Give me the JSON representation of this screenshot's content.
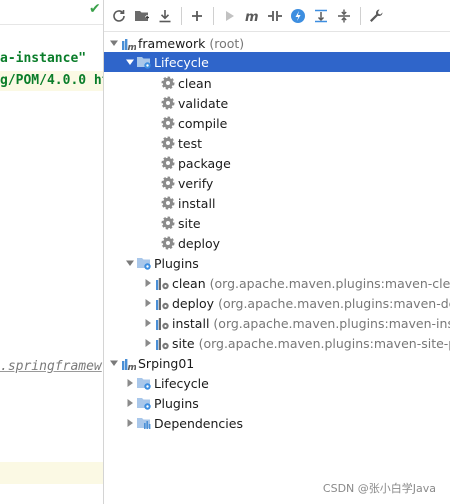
{
  "editor": {
    "code_lines": [
      "a-instance\"",
      "g/POM/4.0.0 ht"
    ],
    "link_line": ".springframew"
  },
  "toolbar": {
    "buttons": [
      {
        "name": "reload-icon"
      },
      {
        "name": "add-project-folder-icon"
      },
      {
        "name": "download-icon"
      },
      {
        "name": "plus-icon"
      },
      {
        "name": "run-icon"
      },
      {
        "name": "execute-goal-icon"
      },
      {
        "name": "toggle-offline-icon"
      },
      {
        "name": "skip-tests-icon"
      },
      {
        "name": "show-dependencies-icon"
      },
      {
        "name": "collapse-all-icon"
      },
      {
        "name": "settings-wrench-icon"
      }
    ]
  },
  "tree": {
    "framework": {
      "label": "framework",
      "suffix": "(root)"
    },
    "lifecycle": {
      "label": "Lifecycle"
    },
    "phases": [
      "clean",
      "validate",
      "compile",
      "test",
      "package",
      "verify",
      "install",
      "site",
      "deploy"
    ],
    "plugins": {
      "label": "Plugins"
    },
    "plugin_items": [
      {
        "label": "clean",
        "detail": "(org.apache.maven.plugins:maven-clean-"
      },
      {
        "label": "deploy",
        "detail": "(org.apache.maven.plugins:maven-depl"
      },
      {
        "label": "install",
        "detail": "(org.apache.maven.plugins:maven-install"
      },
      {
        "label": "site",
        "detail": "(org.apache.maven.plugins:maven-site-plug"
      }
    ],
    "srping01": {
      "label": "Srping01"
    },
    "srping_children": [
      {
        "label": "Lifecycle"
      },
      {
        "label": "Plugins"
      },
      {
        "label": "Dependencies"
      }
    ]
  },
  "watermark": "CSDN @张小白学Java"
}
